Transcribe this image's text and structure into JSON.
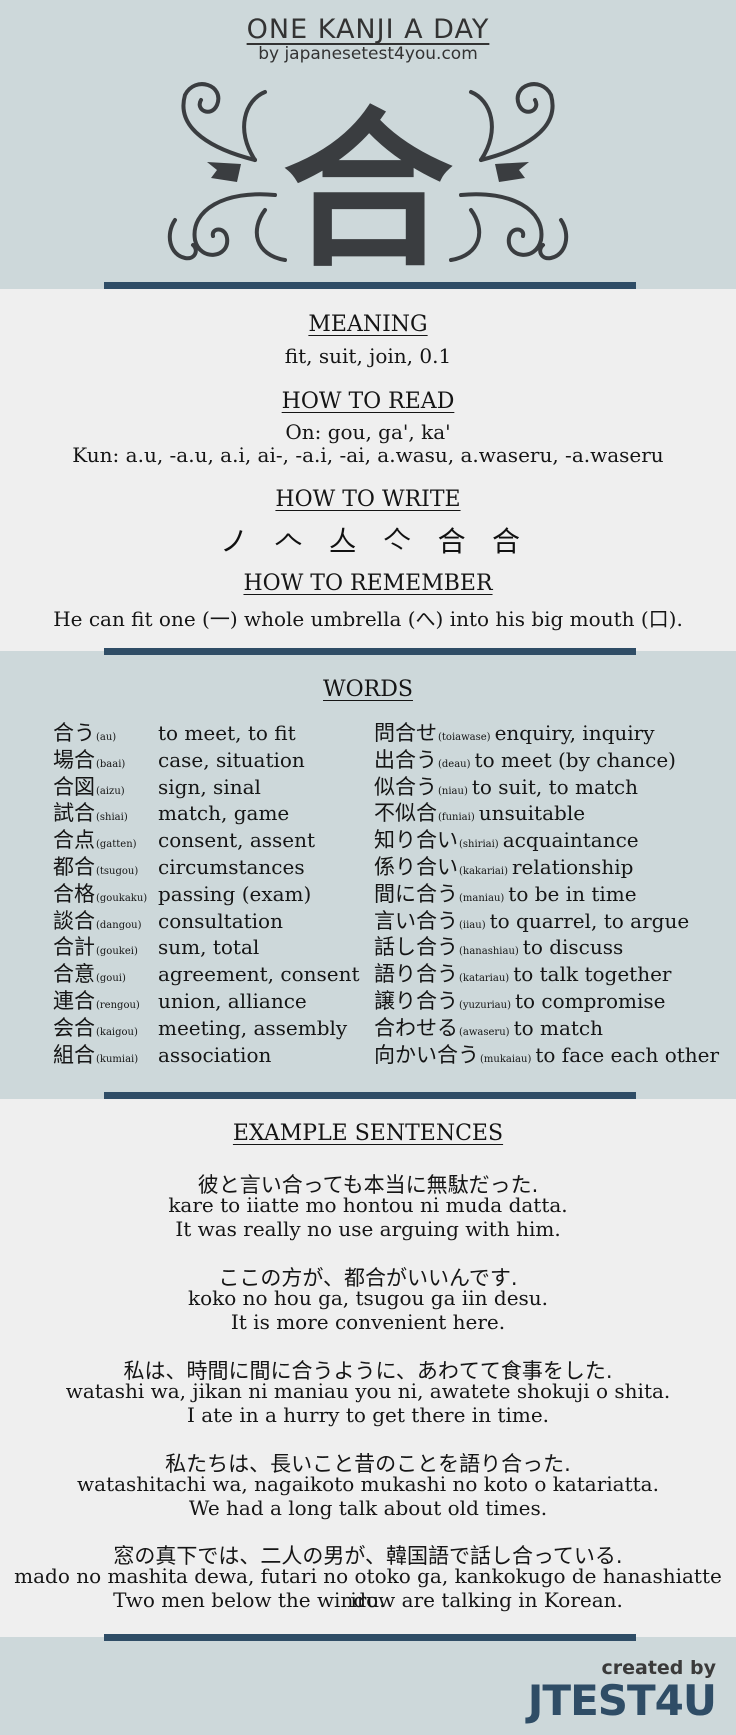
{
  "header": {
    "title": "ONE KANJI A DAY",
    "subtitle": "by japanesetest4you.com",
    "kanji": "合"
  },
  "meaning": {
    "heading": "MEANING",
    "text": "fit, suit, join, 0.1"
  },
  "read": {
    "heading": "HOW TO READ",
    "on": "On: gou, ga', ka'",
    "kun": "Kun: a.u, -a.u, a.i, ai-, -a.i, -ai, a.wasu, a.waseru, -a.waseru"
  },
  "write": {
    "heading": "HOW TO WRITE",
    "strokes": [
      "ノ",
      "𠆢",
      "亼",
      "亽",
      "合",
      "合"
    ]
  },
  "remember": {
    "heading": "HOW TO REMEMBER",
    "text": "He can fit one (一) whole umbrella (へ) into his big mouth (口)."
  },
  "words": {
    "heading": "WORDS",
    "left": [
      {
        "kanji": "合う",
        "reading": "(au)",
        "meaning": "to meet, to fit"
      },
      {
        "kanji": "場合",
        "reading": "(baai)",
        "meaning": "case, situation"
      },
      {
        "kanji": "合図",
        "reading": "(aizu)",
        "meaning": "sign, sinal"
      },
      {
        "kanji": "試合",
        "reading": "(shiai)",
        "meaning": "match, game"
      },
      {
        "kanji": "合点",
        "reading": "(gatten)",
        "meaning": "consent, assent"
      },
      {
        "kanji": "都合",
        "reading": "(tsugou)",
        "meaning": "circumstances"
      },
      {
        "kanji": "合格",
        "reading": "(goukaku)",
        "meaning": "passing (exam)"
      },
      {
        "kanji": "談合",
        "reading": "(dangou)",
        "meaning": "consultation"
      },
      {
        "kanji": "合計",
        "reading": "(goukei)",
        "meaning": "sum, total"
      },
      {
        "kanji": "合意",
        "reading": "(goui)",
        "meaning": "agreement, consent"
      },
      {
        "kanji": "連合",
        "reading": "(rengou)",
        "meaning": "union, alliance"
      },
      {
        "kanji": "会合",
        "reading": "(kaigou)",
        "meaning": "meeting, assembly"
      },
      {
        "kanji": "組合",
        "reading": "(kumiai)",
        "meaning": "association"
      }
    ],
    "right": [
      {
        "kanji": "問合せ",
        "reading": "(toiawase)",
        "meaning": "enquiry, inquiry"
      },
      {
        "kanji": "出合う",
        "reading": "(deau)",
        "meaning": "to meet (by chance)"
      },
      {
        "kanji": "似合う",
        "reading": "(niau)",
        "meaning": "to suit, to match"
      },
      {
        "kanji": "不似合",
        "reading": "(funiai)",
        "meaning": "unsuitable"
      },
      {
        "kanji": "知り合い",
        "reading": "(shiriai)",
        "meaning": "acquaintance"
      },
      {
        "kanji": "係り合い",
        "reading": "(kakariai)",
        "meaning": "relationship"
      },
      {
        "kanji": "間に合う",
        "reading": "(maniau)",
        "meaning": "to be in time"
      },
      {
        "kanji": "言い合う",
        "reading": "(iiau)",
        "meaning": "to quarrel, to argue"
      },
      {
        "kanji": "話し合う",
        "reading": "(hanashiau)",
        "meaning": "to discuss"
      },
      {
        "kanji": "語り合う",
        "reading": "(katariau)",
        "meaning": "to talk together"
      },
      {
        "kanji": "譲り合う",
        "reading": "(yuzuriau)",
        "meaning": "to compromise"
      },
      {
        "kanji": "合わせる",
        "reading": "(awaseru)",
        "meaning": "to match"
      },
      {
        "kanji": "向かい合う",
        "reading": "(mukaiau)",
        "meaning": "to face each other"
      }
    ]
  },
  "examples": {
    "heading": "EXAMPLE SENTENCES",
    "items": [
      {
        "jp": "彼と言い合っても本当に無駄だった.",
        "romaji": "kare to iiatte mo hontou ni muda datta.",
        "en": "It was really no use arguing with him."
      },
      {
        "jp": "ここの方が、都合がいいんです.",
        "romaji": "koko no hou ga, tsugou ga iin desu.",
        "en": "It is more convenient here."
      },
      {
        "jp": "私は、時間に間に合うように、あわてて食事をした.",
        "romaji": "watashi wa, jikan ni maniau you ni, awatete shokuji o shita.",
        "en": "I ate in a hurry to get there in time."
      },
      {
        "jp": "私たちは、長いこと昔のことを語り合った.",
        "romaji": "watashitachi wa, nagaikoto mukashi no koto o katariatta.",
        "en": "We had a long talk about old times."
      },
      {
        "jp": "窓の真下では、二人の男が、韓国語で話し合っている.",
        "romaji": "mado no mashita dewa, futari no otoko ga, kankokugo de hanashiatte iru.",
        "en": "Two men below the window are talking in Korean."
      }
    ]
  },
  "footer": {
    "created_by": "created by",
    "brand": "JTEST4U"
  },
  "colors": {
    "band_blue": "#cdd8da",
    "band_grey": "#efefef",
    "rule": "#2f4d66",
    "ornament": "#3a3d40"
  }
}
